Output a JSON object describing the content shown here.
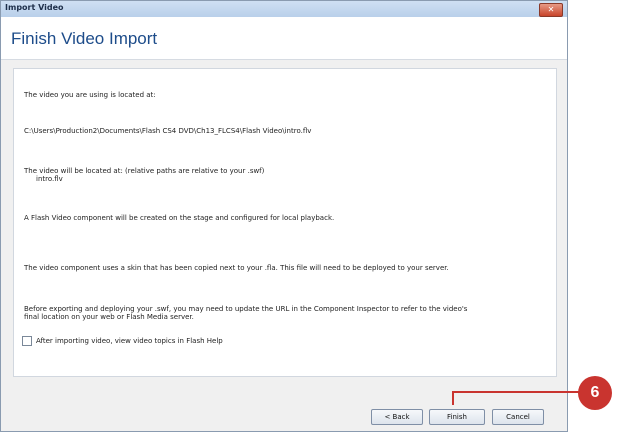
{
  "window": {
    "title": "Import Video",
    "close_label": "✕"
  },
  "header": {
    "title": "Finish Video Import"
  },
  "content": {
    "lines": [
      "The video you are using is located at:",
      "C:\\Users\\Production2\\Documents\\Flash CS4 DVD\\Ch13_FLCS4\\Flash Video\\intro.flv",
      "The video will be located at: (relative paths are relative to your .swf)",
      "intro.flv",
      "A Flash Video component will be created on the stage and configured for local playback.",
      "The video component uses a skin that has been copied next to your .fla. This file will need to be deployed to your server.",
      "Before exporting and deploying your .swf, you may need to update the URL in the Component Inspector to refer to the video's",
      "final location on your web or Flash Media server."
    ],
    "checkbox_label": "After importing video, view video topics in Flash Help"
  },
  "buttons": {
    "back": "< Back",
    "finish": "Finish",
    "cancel": "Cancel"
  },
  "callout": {
    "number": "6",
    "color": "#c9342f"
  }
}
